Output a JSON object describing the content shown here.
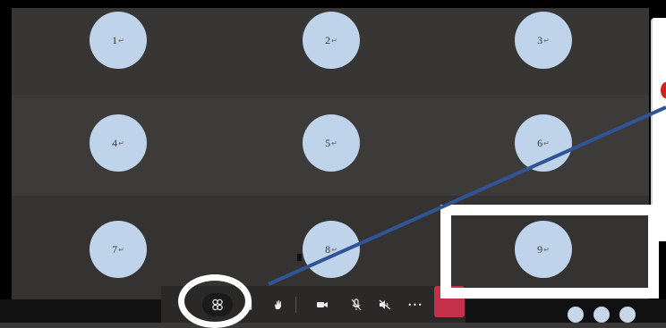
{
  "participants": [
    {
      "label": "1"
    },
    {
      "label": "2"
    },
    {
      "label": "3"
    },
    {
      "label": "4"
    },
    {
      "label": "5"
    },
    {
      "label": "6"
    },
    {
      "label": "7"
    },
    {
      "label": "8"
    },
    {
      "label": "9"
    }
  ],
  "avatar_mark": "↵",
  "toolbar": {
    "more_label": "•••"
  },
  "colors": {
    "avatar": "#bfd3ea",
    "tile_background": "#383635",
    "toolbar": "#2a2928",
    "leave_button": "#c4314b",
    "callout_line": "#2f5597",
    "highlight": "#ffffff"
  },
  "icons": {
    "layout": "gallery-layout-icon",
    "share": "share-screen-icon",
    "raise_hand": "raise-hand-icon",
    "camera": "video-camera-icon",
    "mic": "microphone-muted-icon",
    "speaker": "speaker-muted-icon",
    "more": "more-options-icon",
    "leave": "leave-call-icon"
  }
}
